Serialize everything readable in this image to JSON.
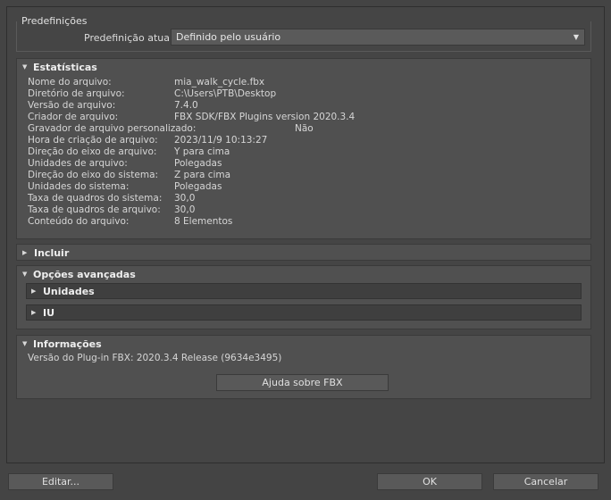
{
  "presets": {
    "title": "Predefinições",
    "current_label": "Predefinição atual:",
    "current_value": "Definido pelo usuário"
  },
  "statistics": {
    "title": "Estatísticas",
    "rows": [
      {
        "label": "Nome do arquivo:",
        "value": "mia_walk_cycle.fbx"
      },
      {
        "label": "Diretório de arquivo:",
        "value": "C:\\Users\\PTB\\Desktop"
      },
      {
        "label": "Versão de arquivo:",
        "value": "7.4.0"
      },
      {
        "label": "Criador de arquivo:",
        "value": "FBX SDK/FBX Plugins version 2020.3.4"
      },
      {
        "label": "Gravador de arquivo personalizado:",
        "value": "Não"
      },
      {
        "label": "Hora de criação de arquivo:",
        "value": "2023/11/9  10:13:27"
      },
      {
        "label": "Direção do eixo de arquivo:",
        "value": "Y para cima"
      },
      {
        "label": "Unidades de arquivo:",
        "value": "Polegadas"
      },
      {
        "label": "Direção do eixo do sistema:",
        "value": "Z para cima"
      },
      {
        "label": "Unidades do sistema:",
        "value": "Polegadas"
      },
      {
        "label": "Taxa de quadros do sistema:",
        "value": "30,0"
      },
      {
        "label": "Taxa de quadros de arquivo:",
        "value": "30,0"
      },
      {
        "label": "Conteúdo do arquivo:",
        "value": "8 Elementos"
      }
    ]
  },
  "include": {
    "title": "Incluir"
  },
  "advanced": {
    "title": "Opções avançadas",
    "units_title": "Unidades",
    "ui_title": "IU"
  },
  "info": {
    "title": "Informações",
    "plugin_version": "Versão do Plug-in FBX: 2020.3.4 Release (9634e3495)",
    "help_button": "Ajuda sobre FBX"
  },
  "footer": {
    "edit_button": "Editar...",
    "ok_button": "OK",
    "cancel_button": "Cancelar"
  },
  "icons": {
    "expanded": "triangle-down-icon",
    "collapsed": "triangle-right-icon",
    "dropdown": "chevron-down-icon"
  }
}
